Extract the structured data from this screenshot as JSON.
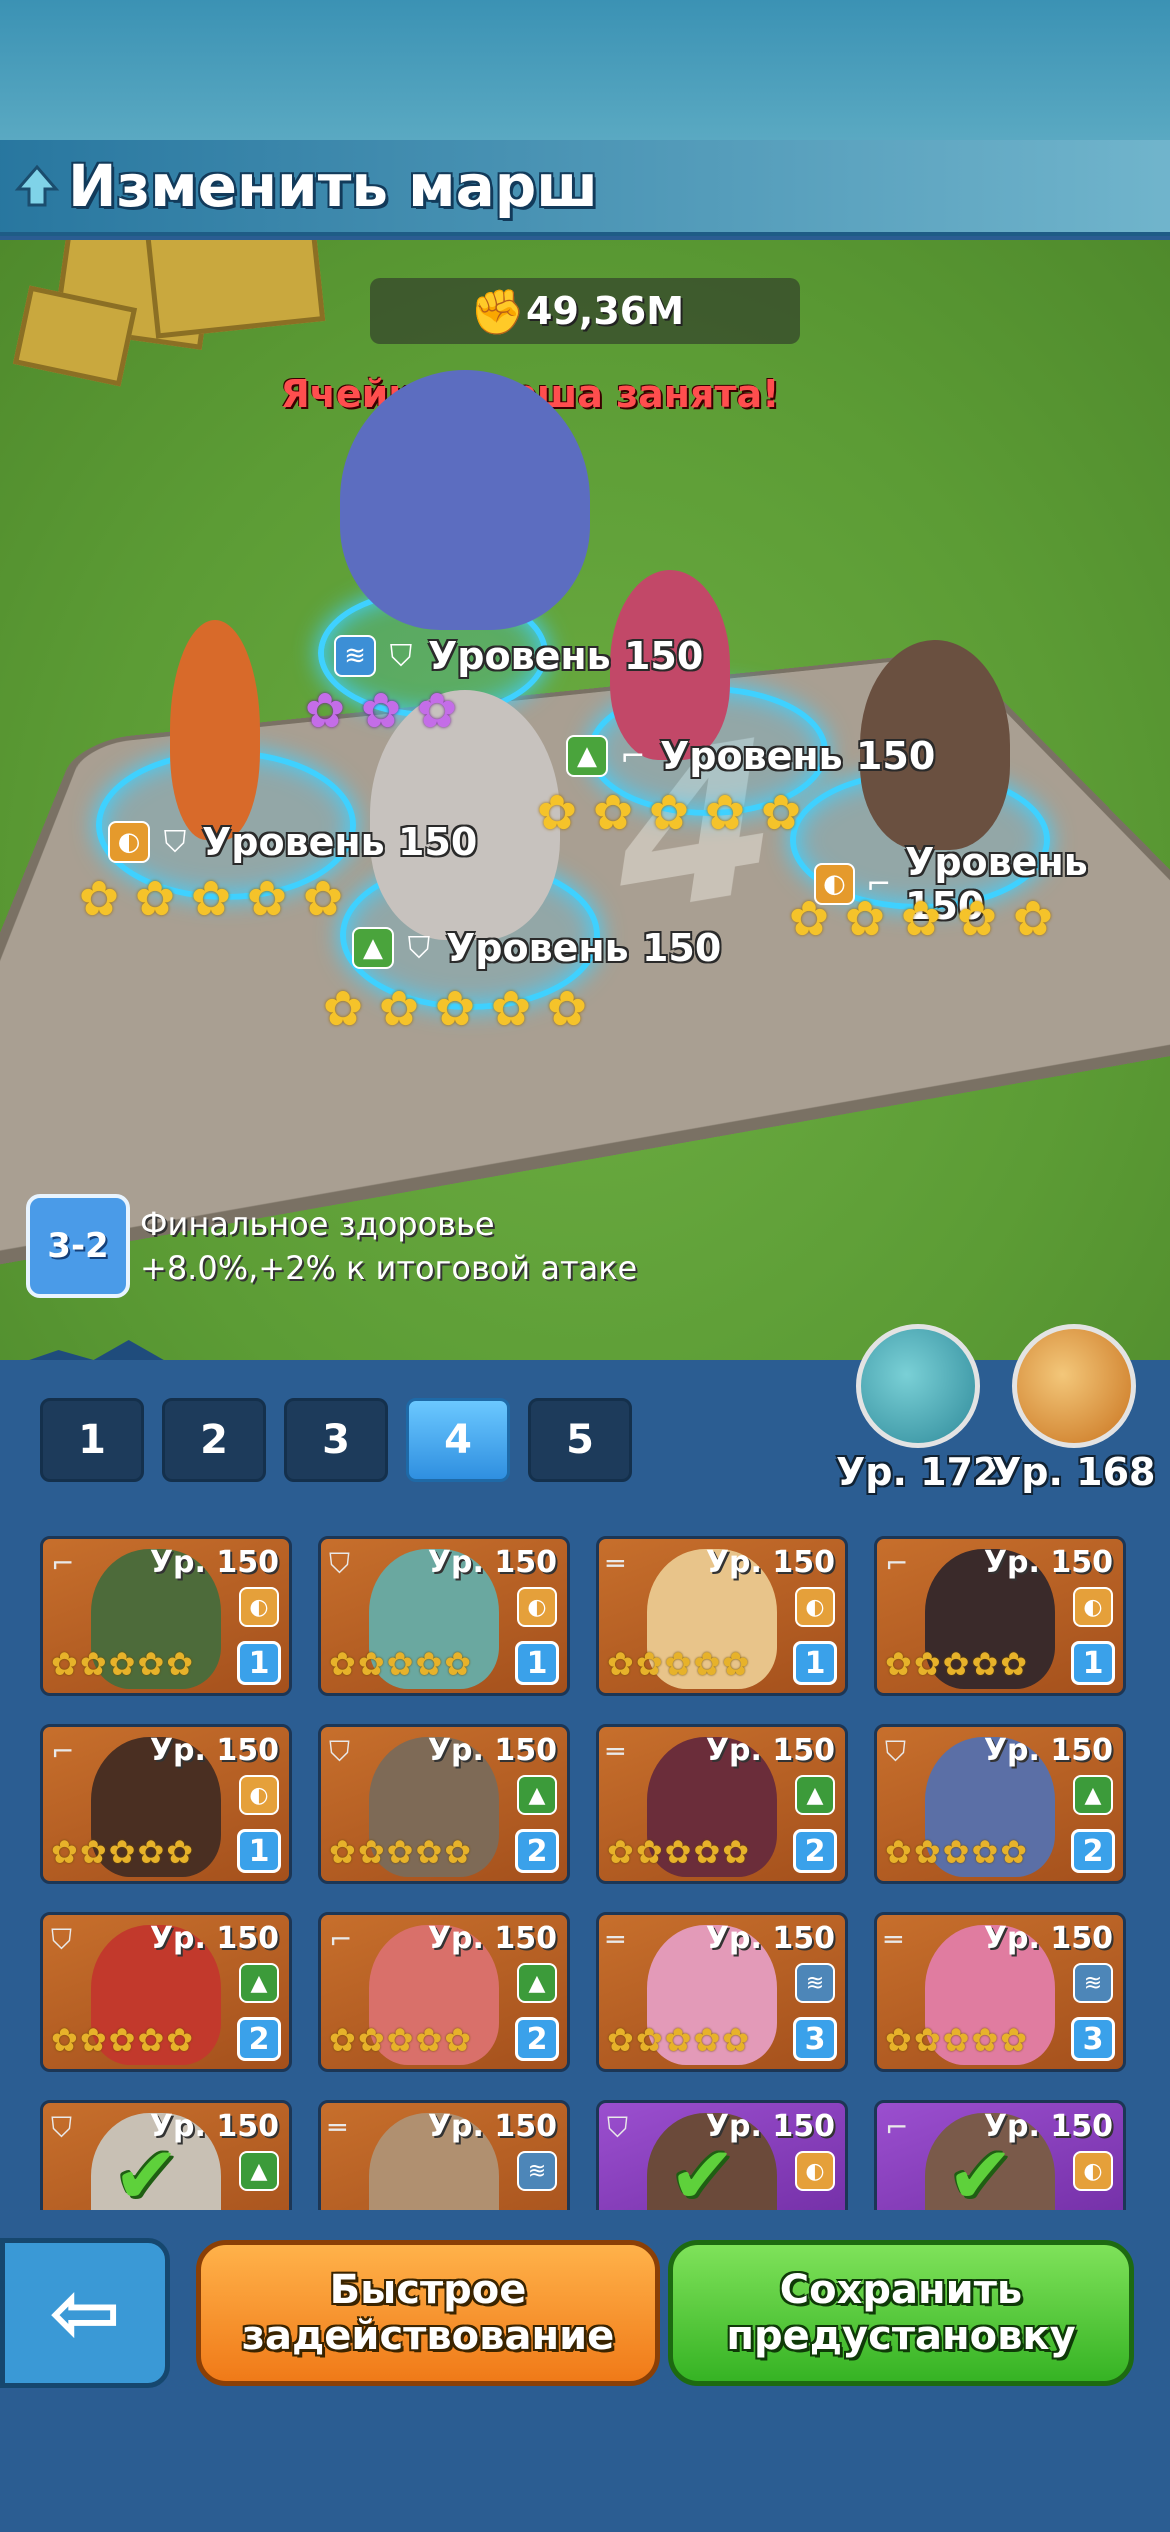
{
  "header": {
    "title": "Изменить марш"
  },
  "march": {
    "power": "49,36M",
    "warning": "Ячейка марша занята!",
    "slot_number": "4",
    "heroes": [
      {
        "level": "Уровень 150",
        "faction_icon": "wave-icon",
        "role_icon": "shield-icon",
        "stars": 3,
        "star_color": "purple"
      },
      {
        "level": "Уровень 150",
        "faction_icon": "mountain-icon",
        "role_icon": "pistol-icon",
        "stars": 5,
        "star_color": "gold"
      },
      {
        "level": "Уровень 150",
        "faction_icon": "fire-icon",
        "role_icon": "shield-icon",
        "stars": 5,
        "star_color": "gold"
      },
      {
        "level": "Уровень 150",
        "faction_icon": "fire-icon",
        "role_icon": "pistol-icon",
        "stars": 5,
        "star_color": "gold"
      },
      {
        "level": "Уровень 150",
        "faction_icon": "mountain-icon",
        "role_icon": "shield-icon",
        "stars": 5,
        "star_color": "gold"
      }
    ]
  },
  "bonus": {
    "badge": "3-2",
    "line1": "Финальное здоровье",
    "line2": "+8.0%,+2% к итоговой атаке"
  },
  "presets": [
    "1",
    "2",
    "3",
    "4",
    "5"
  ],
  "active_preset": "4",
  "pets": [
    {
      "level": "Ур. 172",
      "name": "dragon-pet"
    },
    {
      "level": "Ур. 168",
      "name": "eagle-pet"
    }
  ],
  "roster": [
    {
      "level": "Ур. 150",
      "role": "pistol",
      "faction": "fire",
      "count": "1",
      "color": "#4d6b3a",
      "deployed": false
    },
    {
      "level": "Ур. 150",
      "role": "shield",
      "faction": "fire",
      "count": "1",
      "color": "#6aa8a0",
      "deployed": false
    },
    {
      "level": "Ур. 150",
      "role": "rifle",
      "faction": "fire",
      "count": "1",
      "color": "#e8c48a",
      "deployed": false
    },
    {
      "level": "Ур. 150",
      "role": "pistol",
      "faction": "fire",
      "count": "1",
      "color": "#3a2a2a",
      "deployed": false
    },
    {
      "level": "Ур. 150",
      "role": "pistol",
      "faction": "fire",
      "count": "1",
      "color": "#4a2f22",
      "deployed": false
    },
    {
      "level": "Ур. 150",
      "role": "shield",
      "faction": "mountain",
      "count": "2",
      "color": "#7e6a56",
      "deployed": false
    },
    {
      "level": "Ур. 150",
      "role": "rifle",
      "faction": "mountain",
      "count": "2",
      "color": "#6b2d3a",
      "deployed": false
    },
    {
      "level": "Ур. 150",
      "role": "shield",
      "faction": "mountain",
      "count": "2",
      "color": "#5b6fa6",
      "deployed": false
    },
    {
      "level": "Ур. 150",
      "role": "shield",
      "faction": "mountain",
      "count": "2",
      "color": "#c2392c",
      "deployed": false
    },
    {
      "level": "Ур. 150",
      "role": "pistol",
      "faction": "mountain",
      "count": "2",
      "color": "#d9706a",
      "deployed": false
    },
    {
      "level": "Ур. 150",
      "role": "rifle",
      "faction": "wave",
      "count": "3",
      "color": "#e39ab8",
      "deployed": false
    },
    {
      "level": "Ур. 150",
      "role": "rifle",
      "faction": "wave",
      "count": "3",
      "color": "#e07ca0",
      "deployed": false
    },
    {
      "level": "Ур. 150",
      "role": "shield",
      "faction": "mountain",
      "count": "",
      "color": "#c8c0b4",
      "deployed": true
    },
    {
      "level": "Ур. 150",
      "role": "rifle",
      "faction": "wave",
      "count": "",
      "color": "#b09070",
      "deployed": false
    },
    {
      "level": "Ур. 150",
      "role": "shield",
      "faction": "fire",
      "count": "",
      "color": "#6b4a3a",
      "deployed": true,
      "purple": true
    },
    {
      "level": "Ур. 150",
      "role": "pistol",
      "faction": "fire",
      "count": "",
      "color": "#7a5a4a",
      "deployed": true,
      "purple": true
    }
  ],
  "buttons": {
    "back": "⇦",
    "quick_line1": "Быстрое",
    "quick_line2": "задействование",
    "save_line1": "Сохранить",
    "save_line2": "предустановку"
  }
}
